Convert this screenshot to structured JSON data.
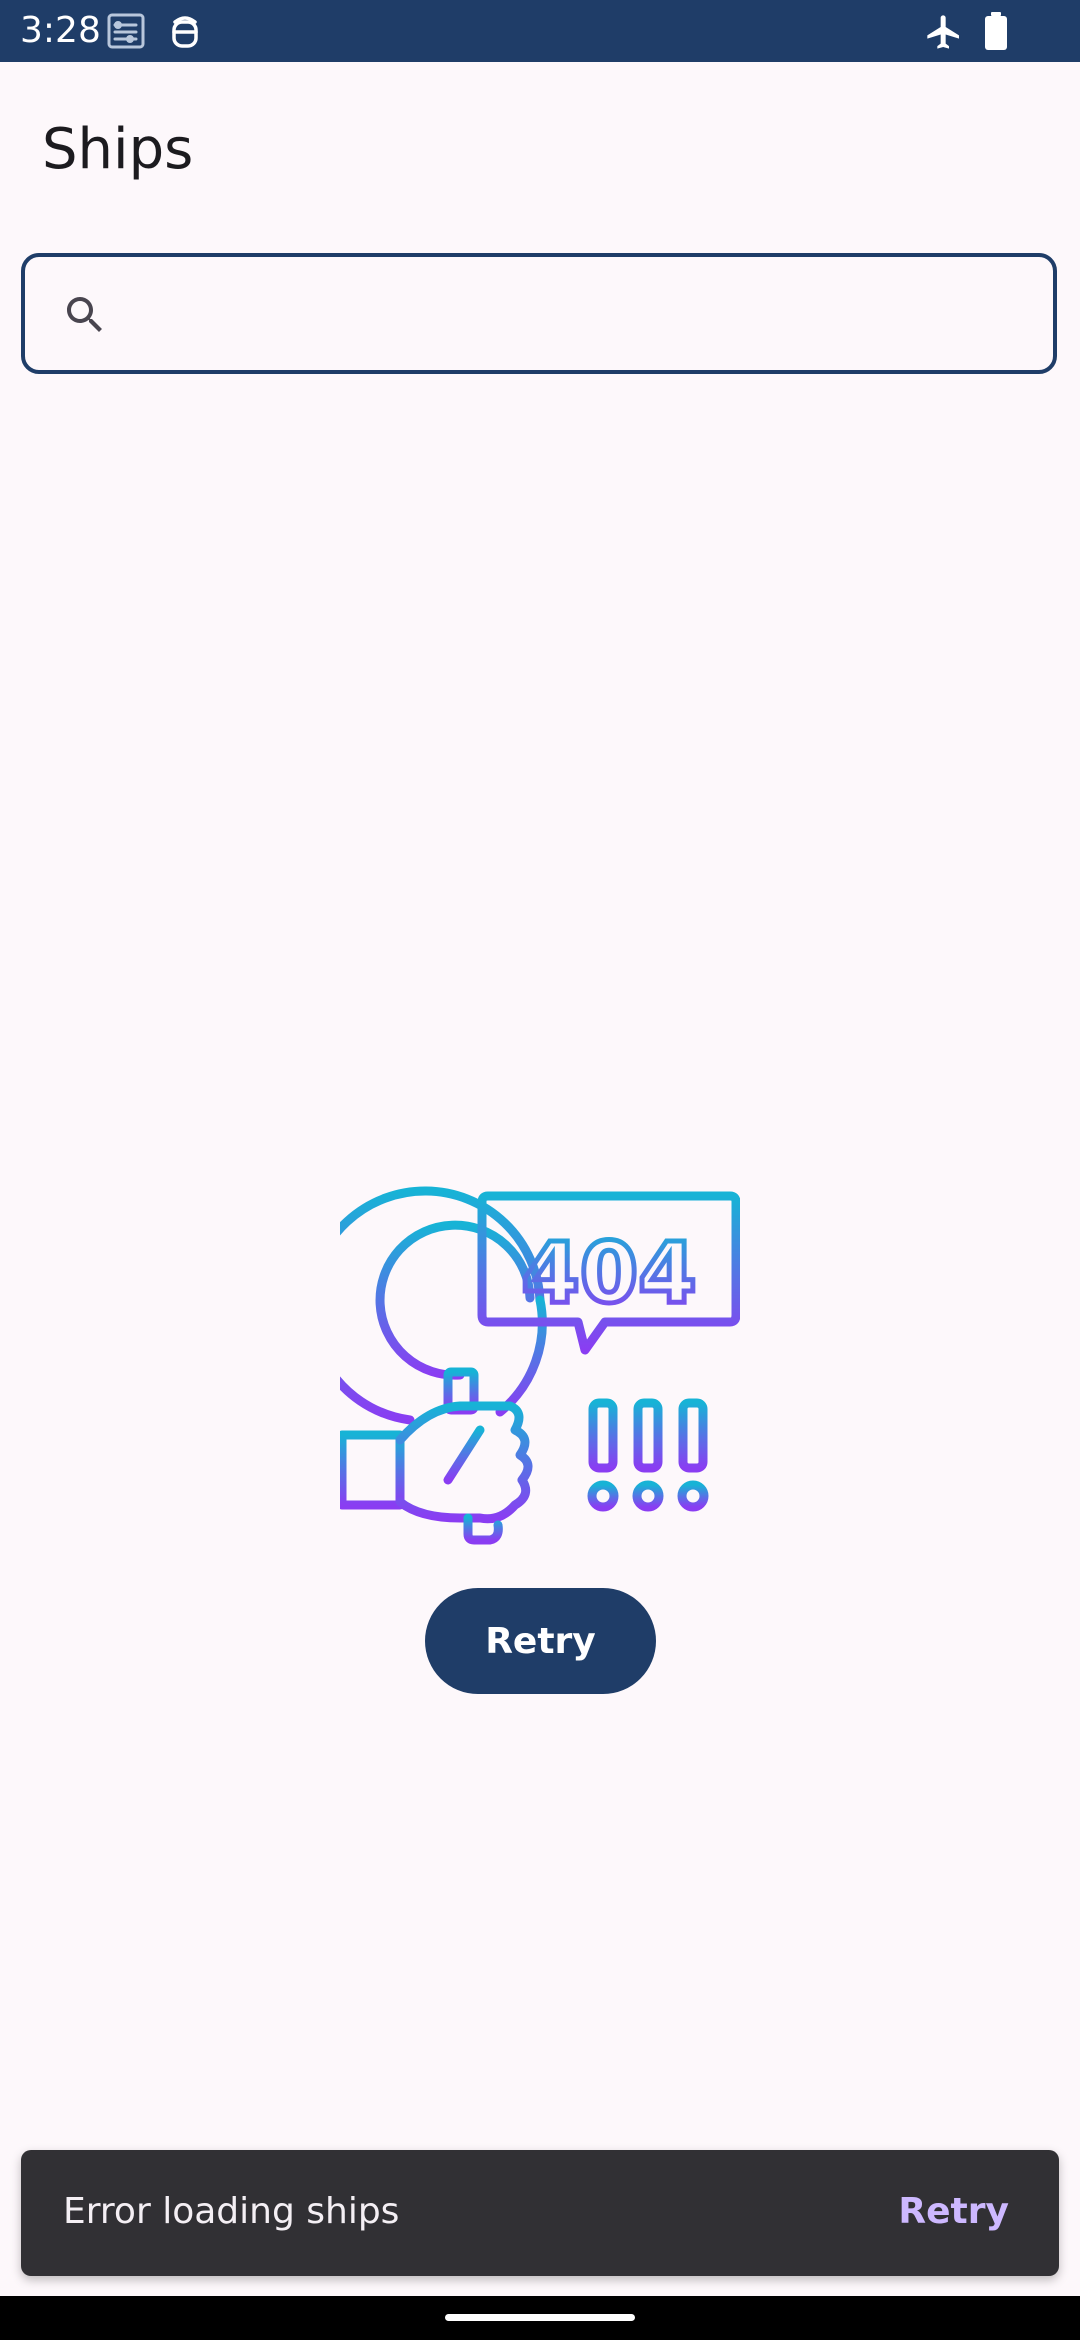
{
  "status_bar": {
    "time": "3:28",
    "left_icons": [
      "network-activity-icon",
      "debug-icon"
    ],
    "right_icons": [
      "airplane-mode-icon",
      "battery-icon"
    ],
    "background": "#1f3d68"
  },
  "header": {
    "title": "Ships"
  },
  "search": {
    "value": "",
    "placeholder": "",
    "icon": "search-icon"
  },
  "error_state": {
    "illustration_text": "404",
    "illustration_icon": "magnifier-404-icon",
    "retry_label": "Retry",
    "gradient": [
      "#17b3d6",
      "#8a3df2"
    ]
  },
  "snackbar": {
    "message": "Error loading ships",
    "action_label": "Retry",
    "action_color": "#cdb8ff"
  },
  "theme": {
    "primary": "#1f3d68",
    "background": "#fdf8fb",
    "snackbar_bg": "#313034"
  }
}
